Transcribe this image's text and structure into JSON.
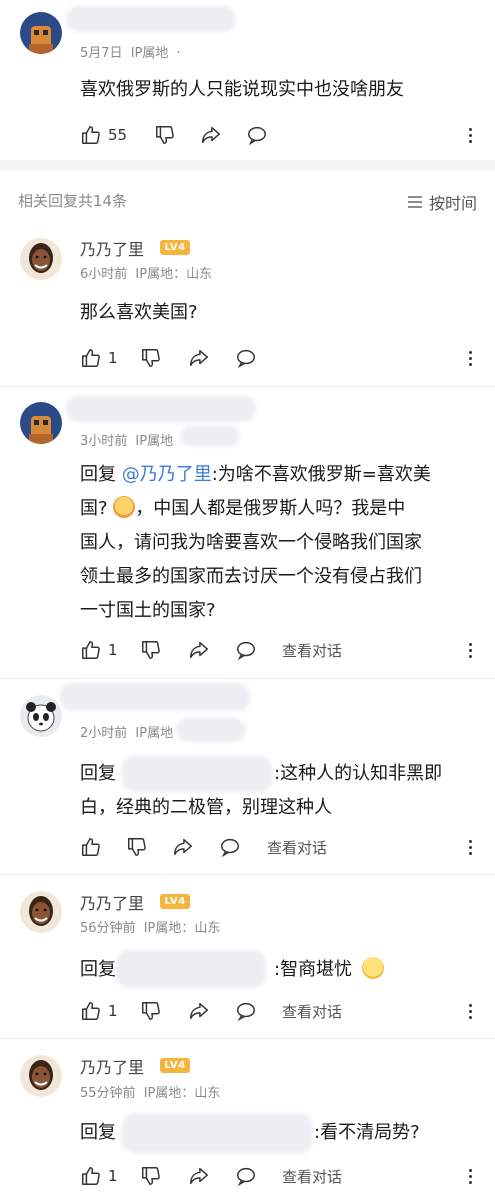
{
  "top_comment": {
    "date": "5月7日",
    "ip_label": "IP属地",
    "ip_suffix": "·",
    "text": "喜欢俄罗斯的人只能说现实中也没啥朋友",
    "likes": "55"
  },
  "replies_header": {
    "count_label": "相关回复共14条",
    "sort_label": "按时间",
    "sort_icon": "menu-lines-icon"
  },
  "replies": [
    {
      "user": "乃乃了里",
      "level": "LV4",
      "time": "6小时前",
      "ip": "IP属地：山东",
      "text": "那么喜欢美国?",
      "likes": "1"
    },
    {
      "time": "3小时前",
      "ip": "IP属地",
      "reply_prefix": "回复",
      "mention": "@乃乃了里",
      "text_1": ":为啥不喜欢俄罗斯=喜欢美",
      "text_2a": "国?",
      "text_2b": "，中国人都是俄罗斯人吗？我是中",
      "text_3": "国人，请问我为啥要喜欢一个侵略我们国家",
      "text_4": "领土最多的国家而去讨厌一个没有侵占我们",
      "text_5": "一寸国土的国家?",
      "likes": "1",
      "view_conversation": "查看对话"
    },
    {
      "time": "2小时前",
      "ip": "IP属地",
      "reply_prefix": "回复",
      "text_1": ":这种人的认知非黑即",
      "text_2": "白，经典的二极管，别理这种人",
      "view_conversation": "查看对话"
    },
    {
      "user": "乃乃了里",
      "level": "LV4",
      "time": "56分钟前",
      "ip": "IP属地：山东",
      "reply_prefix": "回复",
      "text": ":智商堪忧",
      "likes": "1",
      "view_conversation": "查看对话"
    },
    {
      "user": "乃乃了里",
      "level": "LV4",
      "time": "55分钟前",
      "ip": "IP属地：山东",
      "reply_prefix": "回复",
      "text": ":看不清局势?",
      "likes": "1",
      "view_conversation": "查看对话"
    }
  ],
  "colors": {
    "link": "#3c7bd6",
    "level_badge": "#f3b53c",
    "meta_gray": "#8a8a8a"
  }
}
